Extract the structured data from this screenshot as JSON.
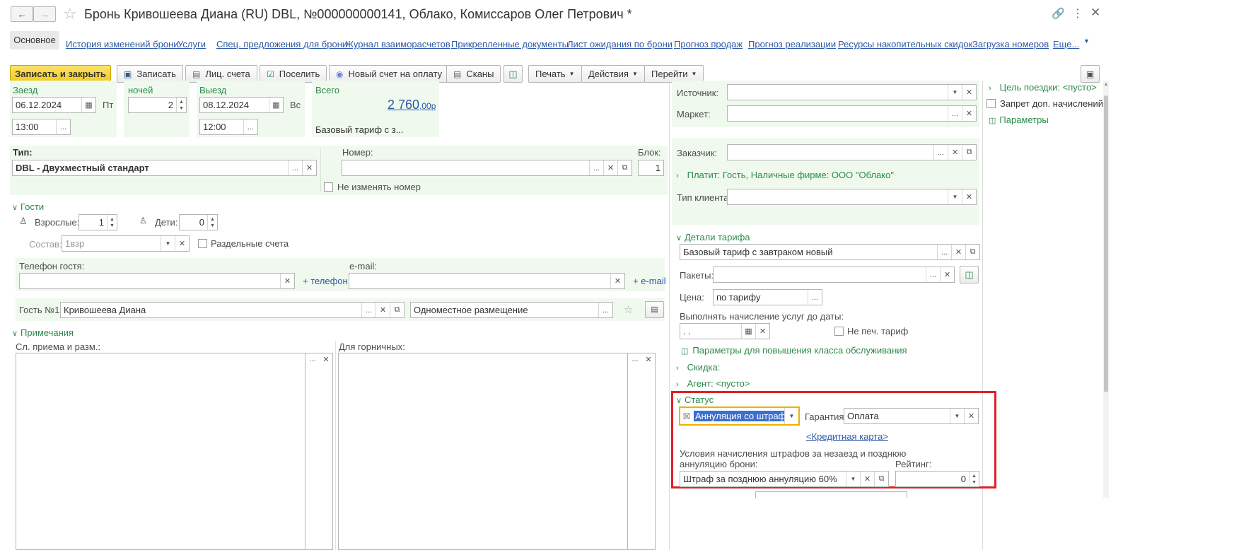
{
  "window": {
    "title": "Бронь Кривошеева Диана (RU) DBL, №000000000141, Облако, Комиссаров Олег Петрович *"
  },
  "tabs": {
    "main": "Основное",
    "links": [
      "История изменений брони",
      "Услуги",
      "Спец. предложения для брони",
      "Журнал взаиморасчетов",
      "Прикрепленные документы",
      "Лист ожидания по брони",
      "Прогноз продаж",
      "Прогноз реализации",
      "Ресурсы накопительных скидок",
      "Загрузка номеров",
      "Еще..."
    ]
  },
  "toolbar": {
    "save_close": "Записать и закрыть",
    "save": "Записать",
    "accounts": "Лиц. счета",
    "checkin": "Поселить",
    "new_invoice": "Новый счет на оплату",
    "scans": "Сканы",
    "print": "Печать",
    "actions": "Действия",
    "goto": "Перейти"
  },
  "stay": {
    "arrival_label": "Заезд",
    "arrival_date": "06.12.2024",
    "arrival_dow": "Пт",
    "arrival_time": "13:00",
    "nights_label": "ночей",
    "nights": "2",
    "departure_label": "Выезд",
    "departure_date": "08.12.2024",
    "departure_dow": "Вс",
    "departure_time": "12:00",
    "total_label": "Всего",
    "total_main": "2 760",
    "total_cents": ",00р",
    "tariff_short": "Базовый тариф с з..."
  },
  "room": {
    "type_label": "Тип:",
    "type_value": "DBL - Двухместный стандарт",
    "number_label": "Номер:",
    "number_value": "",
    "block_label": "Блок:",
    "block_value": "1",
    "no_change_label": "Не изменять номер"
  },
  "guests": {
    "header": "Гости",
    "adults_label": "Взрослые:",
    "adults": "1",
    "kids_label": "Дети:",
    "kids": "0",
    "composition_label": "Состав:",
    "composition_value": "1взр",
    "separate_label": "Раздельные счета",
    "phone_label": "Телефон гостя:",
    "add_phone": "+ телефон",
    "email_label": "e-mail:",
    "add_email": "+ e-mail",
    "guest1_label": "Гость №1:",
    "guest1_name": "Кривошеева Диана",
    "guest1_placement": "Одноместное размещение"
  },
  "notes": {
    "header": "Примечания",
    "reception_label": "Сл. приема и разм.:",
    "maids_label": "Для горничных:"
  },
  "right": {
    "source_label": "Источник:",
    "market_label": "Маркет:",
    "customer_label": "Заказчик:",
    "payer_text": "Платит: Гость, Наличные фирме: ООО \"Облако\"",
    "client_type_label": "Тип клиента:",
    "tariff_header": "Детали тарифа",
    "tariff_value": "Базовый тариф с завтраком новый",
    "packages_label": "Пакеты:",
    "price_label": "Цена:",
    "price_value": "по тарифу",
    "charge_until_label": "Выполнять начисление услуг до даты:",
    "charge_until_value": " .  .",
    "no_print_tariff": "Не печ. тариф",
    "upgrade_params": "Параметры для повышения класса обслуживания",
    "discount": "Скидка:",
    "agent": "Агент: <пусто>"
  },
  "status": {
    "header": "Статус",
    "value": "Аннуляция со штрафом",
    "guarantee_label": "Гарантия:",
    "guarantee_value": "Оплата",
    "credit_card": "<Кредитная карта>",
    "penalty_label_1": "Условия начисления штрафов за незаезд и позднюю",
    "penalty_label_2": "аннуляцию брони:",
    "penalty_value": "Штраф за позднюю аннуляцию 60%",
    "rating_label": "Рейтинг:",
    "rating_value": "0"
  },
  "side": {
    "trip_goal": "Цель поездки: <пусто>",
    "no_extra_charges": "Запрет доп. начислений",
    "params": "Параметры"
  },
  "colors": {
    "accent_green": "#2a8a4a",
    "save_yellow": "#f5d53a",
    "link_blue": "#2b58a6",
    "highlight_red": "#e0202a"
  }
}
